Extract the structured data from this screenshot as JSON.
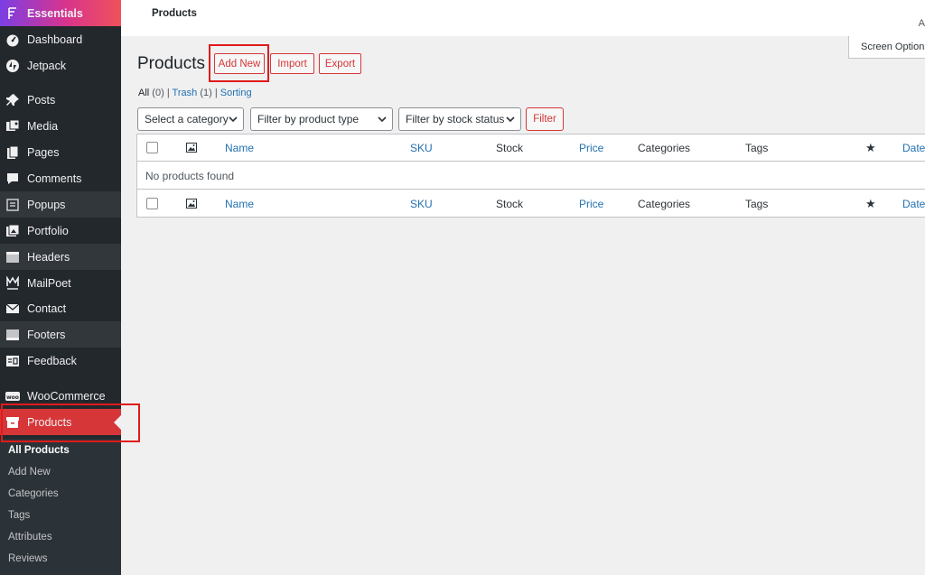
{
  "sidebar": {
    "items": [
      {
        "label": "Essentials",
        "icon": "essentials-icon"
      },
      {
        "label": "Dashboard",
        "icon": "dashboard-icon"
      },
      {
        "label": "Jetpack",
        "icon": "jetpack-icon"
      },
      {
        "label": "Posts",
        "icon": "pin-icon"
      },
      {
        "label": "Media",
        "icon": "media-icon"
      },
      {
        "label": "Pages",
        "icon": "pages-icon"
      },
      {
        "label": "Comments",
        "icon": "comments-icon"
      },
      {
        "label": "Popups",
        "icon": "popups-icon"
      },
      {
        "label": "Portfolio",
        "icon": "portfolio-icon"
      },
      {
        "label": "Headers",
        "icon": "headers-icon"
      },
      {
        "label": "MailPoet",
        "icon": "mailpoet-icon"
      },
      {
        "label": "Contact",
        "icon": "envelope-icon"
      },
      {
        "label": "Footers",
        "icon": "footers-icon"
      },
      {
        "label": "Feedback",
        "icon": "feedback-icon"
      },
      {
        "label": "WooCommerce",
        "icon": "woo-icon"
      },
      {
        "label": "Products",
        "icon": "products-icon"
      }
    ],
    "submenu": [
      "All Products",
      "Add New",
      "Categories",
      "Tags",
      "Attributes",
      "Reviews"
    ],
    "accent_color": "#d63638"
  },
  "topbar": {
    "title": "Products",
    "right_fragment": "A"
  },
  "screen_options": "Screen Options",
  "heading": {
    "title": "Products",
    "add_new": "Add New",
    "import": "Import",
    "export": "Export"
  },
  "views": {
    "all": "All",
    "all_count": "(0)",
    "sep": "|",
    "trash": "Trash",
    "trash_count": "(1)",
    "sorting": "Sorting"
  },
  "filters": {
    "category": "Select a category",
    "product_type": "Filter by product type",
    "stock_status": "Filter by stock status",
    "button": "Filter"
  },
  "table": {
    "columns": {
      "name": "Name",
      "sku": "SKU",
      "stock": "Stock",
      "price": "Price",
      "categories": "Categories",
      "tags": "Tags",
      "featured": "★",
      "date": "Date"
    },
    "empty_message": "No products found"
  }
}
